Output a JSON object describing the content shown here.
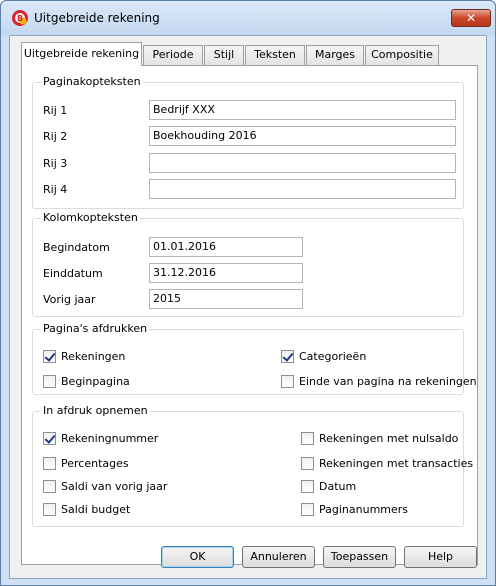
{
  "window": {
    "title": "Uitgebreide rekening",
    "close_glyph": "✕"
  },
  "tabs": [
    {
      "label": "Uitgebreide rekening"
    },
    {
      "label": "Periode"
    },
    {
      "label": "Stijl"
    },
    {
      "label": "Teksten"
    },
    {
      "label": "Marges"
    },
    {
      "label": "Compositie"
    }
  ],
  "page_headers": {
    "title": "Paginakopteksten",
    "rows": [
      {
        "label": "Rij 1",
        "value": "Bedrijf XXX"
      },
      {
        "label": "Rij 2",
        "value": "Boekhouding 2016"
      },
      {
        "label": "Rij 3",
        "value": ""
      },
      {
        "label": "Rij 4",
        "value": ""
      }
    ]
  },
  "column_headers": {
    "title": "Kolomkopteksten",
    "rows": [
      {
        "label": "Begindatom",
        "value": "01.01.2016"
      },
      {
        "label": "Einddatum",
        "value": "31.12.2016"
      },
      {
        "label": "Vorig jaar",
        "value": "2015"
      }
    ]
  },
  "print_pages": {
    "title": "Pagina's afdrukken",
    "options": [
      {
        "label": "Rekeningen",
        "checked": true
      },
      {
        "label": "Categorieën",
        "checked": true
      },
      {
        "label": "Beginpagina",
        "checked": false
      },
      {
        "label": "Einde van pagina na rekeningen",
        "checked": false
      }
    ]
  },
  "include": {
    "title": "In afdruk opnemen",
    "options": [
      {
        "label": "Rekeningnummer",
        "checked": true
      },
      {
        "label": "Rekeningen met nulsaldo",
        "checked": false
      },
      {
        "label": "Percentages",
        "checked": false
      },
      {
        "label": "Rekeningen met transacties",
        "checked": false
      },
      {
        "label": "Saldi van vorig jaar",
        "checked": false
      },
      {
        "label": "Datum",
        "checked": false
      },
      {
        "label": "Saldi budget",
        "checked": false
      },
      {
        "label": "Paginanummers",
        "checked": false
      }
    ]
  },
  "buttons": {
    "ok": "OK",
    "cancel": "Annuleren",
    "apply": "Toepassen",
    "help": "Help"
  },
  "colors": {
    "check": "#1f3a8a",
    "titlebar": "#cfe0f4",
    "close": "#c9462c"
  }
}
